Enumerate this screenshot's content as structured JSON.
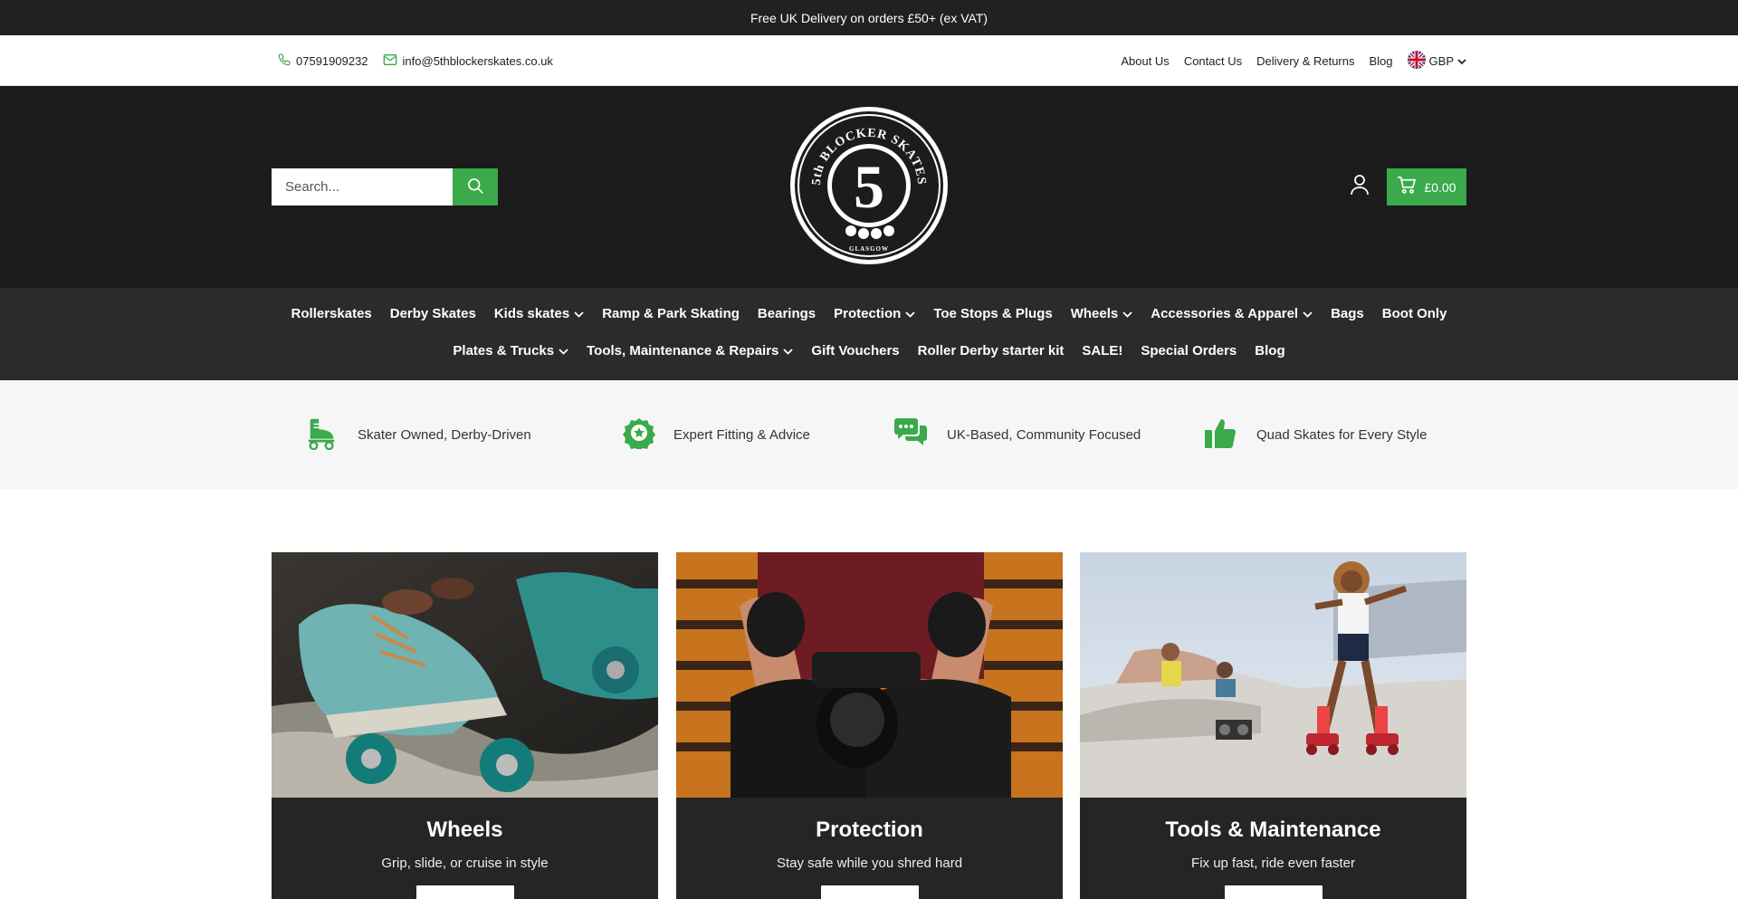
{
  "announcement": "Free UK Delivery on orders £50+ (ex VAT)",
  "utility": {
    "phone": "07591909232",
    "email": "info@5thblockerskates.co.uk",
    "links": [
      "About Us",
      "Contact Us",
      "Delivery & Returns",
      "Blog"
    ],
    "currency": "GBP"
  },
  "header": {
    "search_placeholder": "Search...",
    "logo_text_top": "5th BLOCKER SKATES",
    "logo_numeral": "5",
    "logo_text_bottom": "GLASGOW",
    "cart_total": "£0.00"
  },
  "nav": {
    "row1": [
      {
        "label": "Rollerskates",
        "dropdown": false
      },
      {
        "label": "Derby Skates",
        "dropdown": false
      },
      {
        "label": "Kids skates",
        "dropdown": true
      },
      {
        "label": "Ramp & Park Skating",
        "dropdown": false
      },
      {
        "label": "Bearings",
        "dropdown": false
      },
      {
        "label": "Protection",
        "dropdown": true
      },
      {
        "label": "Toe Stops & Plugs",
        "dropdown": false
      },
      {
        "label": "Wheels",
        "dropdown": true
      },
      {
        "label": "Accessories & Apparel",
        "dropdown": true
      },
      {
        "label": "Bags",
        "dropdown": false
      },
      {
        "label": "Boot Only",
        "dropdown": false
      }
    ],
    "row2": [
      {
        "label": "Plates & Trucks",
        "dropdown": true
      },
      {
        "label": "Tools, Maintenance & Repairs",
        "dropdown": true
      },
      {
        "label": "Gift Vouchers",
        "dropdown": false
      },
      {
        "label": "Roller Derby starter kit",
        "dropdown": false
      },
      {
        "label": "SALE!",
        "dropdown": false
      },
      {
        "label": "Special Orders",
        "dropdown": false
      },
      {
        "label": "Blog",
        "dropdown": false
      }
    ]
  },
  "features": [
    {
      "icon": "roller-skate-icon",
      "text": "Skater Owned, Derby-Driven"
    },
    {
      "icon": "badge-star-icon",
      "text": "Expert Fitting & Advice"
    },
    {
      "icon": "chat-bubbles-icon",
      "text": "UK-Based, Community Focused"
    },
    {
      "icon": "thumbs-up-icon",
      "text": "Quad Skates for Every Style"
    }
  ],
  "cards": [
    {
      "title": "Wheels",
      "subtitle": "Grip, slide, or cruise in style"
    },
    {
      "title": "Protection",
      "subtitle": "Stay safe while you shred hard"
    },
    {
      "title": "Tools & Maintenance",
      "subtitle": "Fix up fast, ride even faster"
    }
  ],
  "colors": {
    "accent": "#3aaa4a",
    "header_bg": "#1c1c1c",
    "nav_bg": "#2b2b2b",
    "announce_bg": "#212121"
  }
}
